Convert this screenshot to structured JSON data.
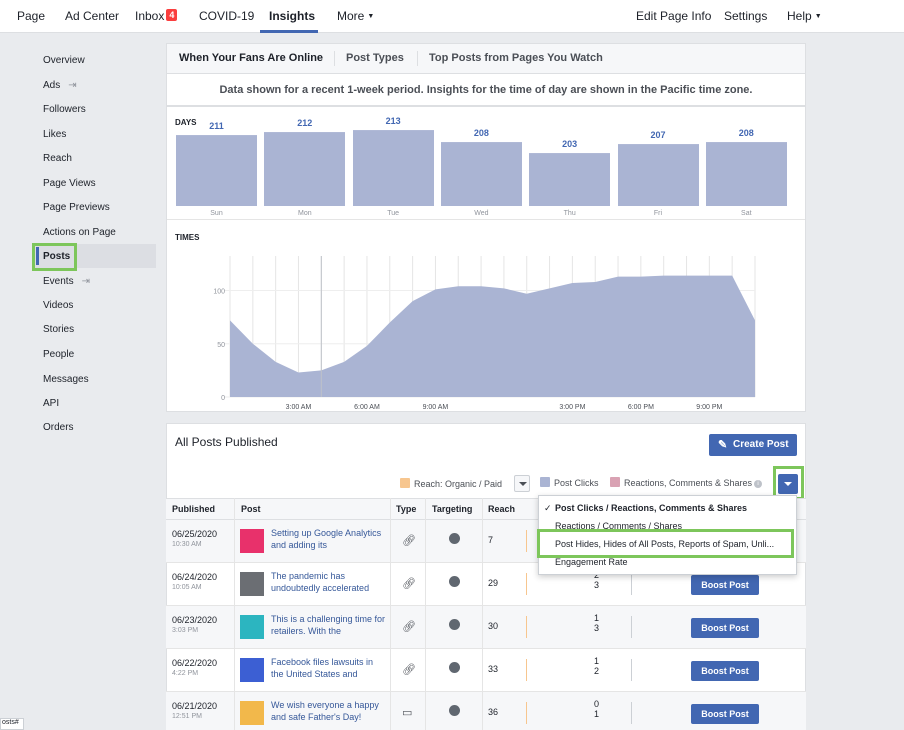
{
  "topnav": {
    "page": "Page",
    "ad_center": "Ad Center",
    "inbox": "Inbox",
    "inbox_badge": "4",
    "covid": "COVID-19",
    "insights": "Insights",
    "more": "More",
    "edit_page_info": "Edit Page Info",
    "settings": "Settings",
    "help": "Help"
  },
  "sidebar": {
    "items": [
      {
        "label": "Overview"
      },
      {
        "label": "Ads"
      },
      {
        "label": "Followers"
      },
      {
        "label": "Likes"
      },
      {
        "label": "Reach"
      },
      {
        "label": "Page Views"
      },
      {
        "label": "Page Previews"
      },
      {
        "label": "Actions on Page"
      },
      {
        "label": "Posts"
      },
      {
        "label": "Events"
      },
      {
        "label": "Videos"
      },
      {
        "label": "Stories"
      },
      {
        "label": "People"
      },
      {
        "label": "Messages"
      },
      {
        "label": "API"
      },
      {
        "label": "Orders"
      }
    ],
    "selected": "Posts"
  },
  "tabs": {
    "fans_online": "When Your Fans Are Online",
    "post_types": "Post Types",
    "top_posts": "Top Posts from Pages You Watch"
  },
  "notice": "Data shown for a recent 1-week period. Insights for the time of day are shown in the Pacific time zone.",
  "days_label": "DAYS",
  "times_label": "TIMES",
  "chart_data": [
    {
      "type": "bar",
      "title": "DAYS",
      "categories": [
        "Sun",
        "Mon",
        "Tue",
        "Wed",
        "Thu",
        "Fri",
        "Sat"
      ],
      "values": [
        211,
        212,
        213,
        208,
        203,
        207,
        208
      ],
      "color": "#aab4d3"
    },
    {
      "type": "area",
      "title": "TIMES",
      "x": [
        0,
        1,
        2,
        3,
        4,
        5,
        6,
        7,
        8,
        9,
        10,
        11,
        12,
        13,
        14,
        15,
        16,
        17,
        18,
        19,
        20,
        21,
        22,
        23
      ],
      "values": [
        72,
        50,
        33,
        23,
        25,
        33,
        48,
        70,
        90,
        101,
        104,
        104,
        102,
        97,
        102,
        107,
        108,
        113,
        113,
        114,
        114,
        114,
        114,
        72
      ],
      "x_tick_labels": [
        "3:00 AM",
        "6:00 AM",
        "9:00 AM",
        "3:00 PM",
        "6:00 PM",
        "9:00 PM"
      ],
      "x_tick_hours": [
        3,
        6,
        9,
        15,
        18,
        21
      ],
      "y_ticks": [
        0,
        50,
        100
      ],
      "ylim": [
        0,
        120
      ],
      "color": "#aab4d3"
    }
  ],
  "posts": {
    "title": "All Posts Published",
    "create_post": "Create Post",
    "legend_reach": "Reach: Organic / Paid",
    "legend_clicks": "Post Clicks",
    "legend_reactions": "Reactions, Comments & Shares",
    "colors": {
      "reach": "#f7c68f",
      "clicks": "#aab4d3",
      "reactions": "#d9a2b3"
    },
    "columns": [
      "Published",
      "Post",
      "Type",
      "Targeting",
      "Reach"
    ],
    "rows": [
      {
        "date": "06/25/2020",
        "time": "10:30 AM",
        "text": "Setting up Google Analytics and adding its",
        "type_icon": "link-icon",
        "reach": "7",
        "c1": "",
        "c2": "",
        "thumb": "#e8316b",
        "boost": ""
      },
      {
        "date": "06/24/2020",
        "time": "10:05 AM",
        "text": "The pandemic has undoubtedly accelerated",
        "type_icon": "link-icon",
        "reach": "29",
        "c1": "2",
        "c2": "3",
        "thumb": "#6b6e73",
        "boost": "Boost Post"
      },
      {
        "date": "06/23/2020",
        "time": "3:03 PM",
        "text": "This is a challenging time for retailers. With the",
        "type_icon": "link-icon",
        "reach": "30",
        "c1": "1",
        "c2": "3",
        "thumb": "#2cb5c0",
        "boost": "Boost Post"
      },
      {
        "date": "06/22/2020",
        "time": "4:22 PM",
        "text": "Facebook files lawsuits in the United States and",
        "type_icon": "link-icon",
        "reach": "33",
        "c1": "1",
        "c2": "2",
        "thumb": "#3c5fd3",
        "boost": "Boost Post"
      },
      {
        "date": "06/21/2020",
        "time": "12:51 PM",
        "text": "We wish everyone a happy and safe Father's Day!",
        "type_icon": "album-icon",
        "reach": "36",
        "c1": "0",
        "c2": "1",
        "thumb": "#f2b84b",
        "boost": "Boost Post"
      }
    ]
  },
  "menu": {
    "items": [
      {
        "label": "Post Clicks / Reactions, Comments & Shares",
        "checked": true
      },
      {
        "label": "Reactions / Comments / Shares",
        "checked": false
      },
      {
        "label": "Post Hides, Hides of All Posts, Reports of Spam, Unli...",
        "checked": false
      },
      {
        "label": "Engagement Rate",
        "checked": false
      }
    ]
  },
  "status_text": "osts#"
}
